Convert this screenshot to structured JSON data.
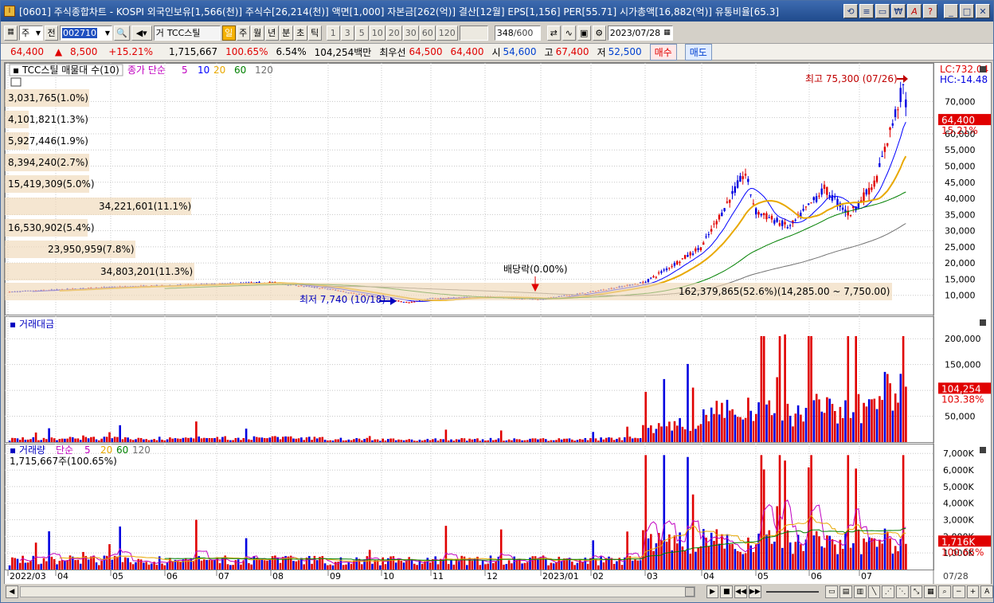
{
  "window": {
    "title": "[0601] 주식종합차트 - KOSPI 외국인보유[1,566(천)] 주식수[26,214(천)] 액면[1,000] 자본금[262(억)] 결산[12월] EPS[1,156] PER[55.71] 시가총액[16,882(억)] 유통비율[65.3]",
    "title_icons": [
      "refresh-icon",
      "history-icon",
      "window-icon",
      "money-icon",
      "font-icon",
      "help-icon"
    ],
    "controls": [
      "minimize-icon",
      "maximize-icon",
      "close-icon"
    ]
  },
  "toolbar": {
    "market_select": "주",
    "prev_label": "전",
    "code_value": "002710",
    "stock_name": "TCC스틸",
    "prefix": "거",
    "periods": [
      "일",
      "주",
      "월",
      "년",
      "분",
      "초",
      "틱"
    ],
    "selected_period": "일",
    "intervals": [
      "1",
      "3",
      "5",
      "10",
      "20",
      "30",
      "60",
      "120"
    ],
    "count_value": "348",
    "count_max": "/600",
    "date_value": "2023/07/28"
  },
  "quote": {
    "price": "64,400",
    "change": "8,500",
    "change_pct": "+15.21%",
    "volume": "1,715,667",
    "volume_ratio": "100.65%",
    "turnover": "6.54%",
    "amount": "104,254백만",
    "priority_label": "최우선",
    "ask": "64,500",
    "bid": "64,400",
    "open_label": "시",
    "open": "54,600",
    "high_label": "고",
    "high": "67,400",
    "low_label": "저",
    "low": "52,500",
    "buy_label": "매수",
    "sell_label": "매도"
  },
  "price_panel": {
    "legend_title": "TCC스틸 매물대 수(10)",
    "ma_label": "종가 단순",
    "ma_periods": [
      "5",
      "10",
      "20",
      "60",
      "120"
    ],
    "ma_colors": [
      "#c000c0",
      "#0000ff",
      "#e8a800",
      "#008000",
      "#707070"
    ],
    "lc_label": "LC:732.04",
    "hc_label": "HC:-14.48",
    "high_annotation": "최고 75,300 (07/26)",
    "low_annotation": "최저 7,740 (10/18)",
    "dividend_annotation": "배당락(0.00%)",
    "last_price_tag": "64,400",
    "last_pct_tag": "15.21%",
    "volume_profile": [
      "3,031,765(1.0%)",
      "4,101,821(1.3%)",
      "5,927,446(1.9%)",
      "8,394,240(2.7%)",
      "15,419,309(5.0%)",
      "34,221,601(11.1%)",
      "16,530,902(5.4%)",
      "23,950,959(7.8%)",
      "34,803,201(11.3%)",
      "162,379,865(52.6%)(14,285.00 ~ 7,750.00)"
    ]
  },
  "amount_panel": {
    "title": "거래대금",
    "last_tag": "104,254",
    "last_pct": "103.38%"
  },
  "volume_panel": {
    "title": "거래량",
    "ma_label": "단순",
    "ma_periods": [
      "5",
      "20",
      "60",
      "120"
    ],
    "current": "1,715,667주(100.65%)",
    "last_tag": "1,716K",
    "last_pct": "100.65%"
  },
  "x_axis": {
    "labels": [
      "2022/03",
      "04",
      "05",
      "06",
      "07",
      "08",
      "09",
      "10",
      "11",
      "12",
      "2023/01",
      "02",
      "03",
      "04",
      "05",
      "06",
      "07"
    ],
    "end_label": "07/28"
  },
  "chart_data": [
    {
      "type": "candlestick",
      "name": "price",
      "y_ticks": [
        10000,
        15000,
        20000,
        25000,
        30000,
        35000,
        40000,
        45000,
        50000,
        55000,
        60000,
        65000,
        70000
      ],
      "y_tick_labels": [
        "10,000",
        "15,000",
        "20,000",
        "25,000",
        "30,000",
        "35,000",
        "40,000",
        "45,000",
        "50,000",
        "55,000",
        "60,000",
        "65,000",
        "70,000"
      ],
      "ylim": [
        5000,
        77000
      ],
      "key_points": [
        {
          "x": "2022/03",
          "y": 11000
        },
        {
          "x": "2022/05",
          "y": 12500
        },
        {
          "x": "2022/07",
          "y": 13500
        },
        {
          "x": "2022/08",
          "y": 14000
        },
        {
          "x": "2022/09",
          "y": 12000
        },
        {
          "x": "2022/10/18",
          "y": 7740
        },
        {
          "x": "2022/11",
          "y": 9000
        },
        {
          "x": "2022/12",
          "y": 9500
        },
        {
          "x": "2023/01",
          "y": 8800
        },
        {
          "x": "2023/02",
          "y": 11000
        },
        {
          "x": "2023/03",
          "y": 14000
        },
        {
          "x": "2023/04",
          "y": 25000
        },
        {
          "x": "2023/04/25",
          "y": 48000
        },
        {
          "x": "2023/05",
          "y": 36000
        },
        {
          "x": "2023/05/20",
          "y": 31000
        },
        {
          "x": "2023/06/10",
          "y": 43000
        },
        {
          "x": "2023/06/25",
          "y": 35000
        },
        {
          "x": "2023/07/10",
          "y": 45000
        },
        {
          "x": "2023/07/26",
          "y": 75300
        },
        {
          "x": "2023/07/28",
          "y": 64400
        }
      ]
    },
    {
      "type": "bar",
      "name": "거래대금",
      "y_ticks": [
        50000,
        100000,
        150000,
        200000
      ],
      "y_tick_labels": [
        "50,000",
        "100,000",
        "150,000",
        "200,000"
      ],
      "ylim": [
        0,
        225000
      ]
    },
    {
      "type": "bar",
      "name": "거래량",
      "y_ticks": [
        1000,
        2000,
        3000,
        4000,
        5000,
        6000,
        7000
      ],
      "y_tick_labels": [
        "1,000K",
        "2,000K",
        "3,000K",
        "4,000K",
        "5,000K",
        "6,000K",
        "7,000K"
      ],
      "ylim": [
        0,
        7300
      ]
    }
  ]
}
